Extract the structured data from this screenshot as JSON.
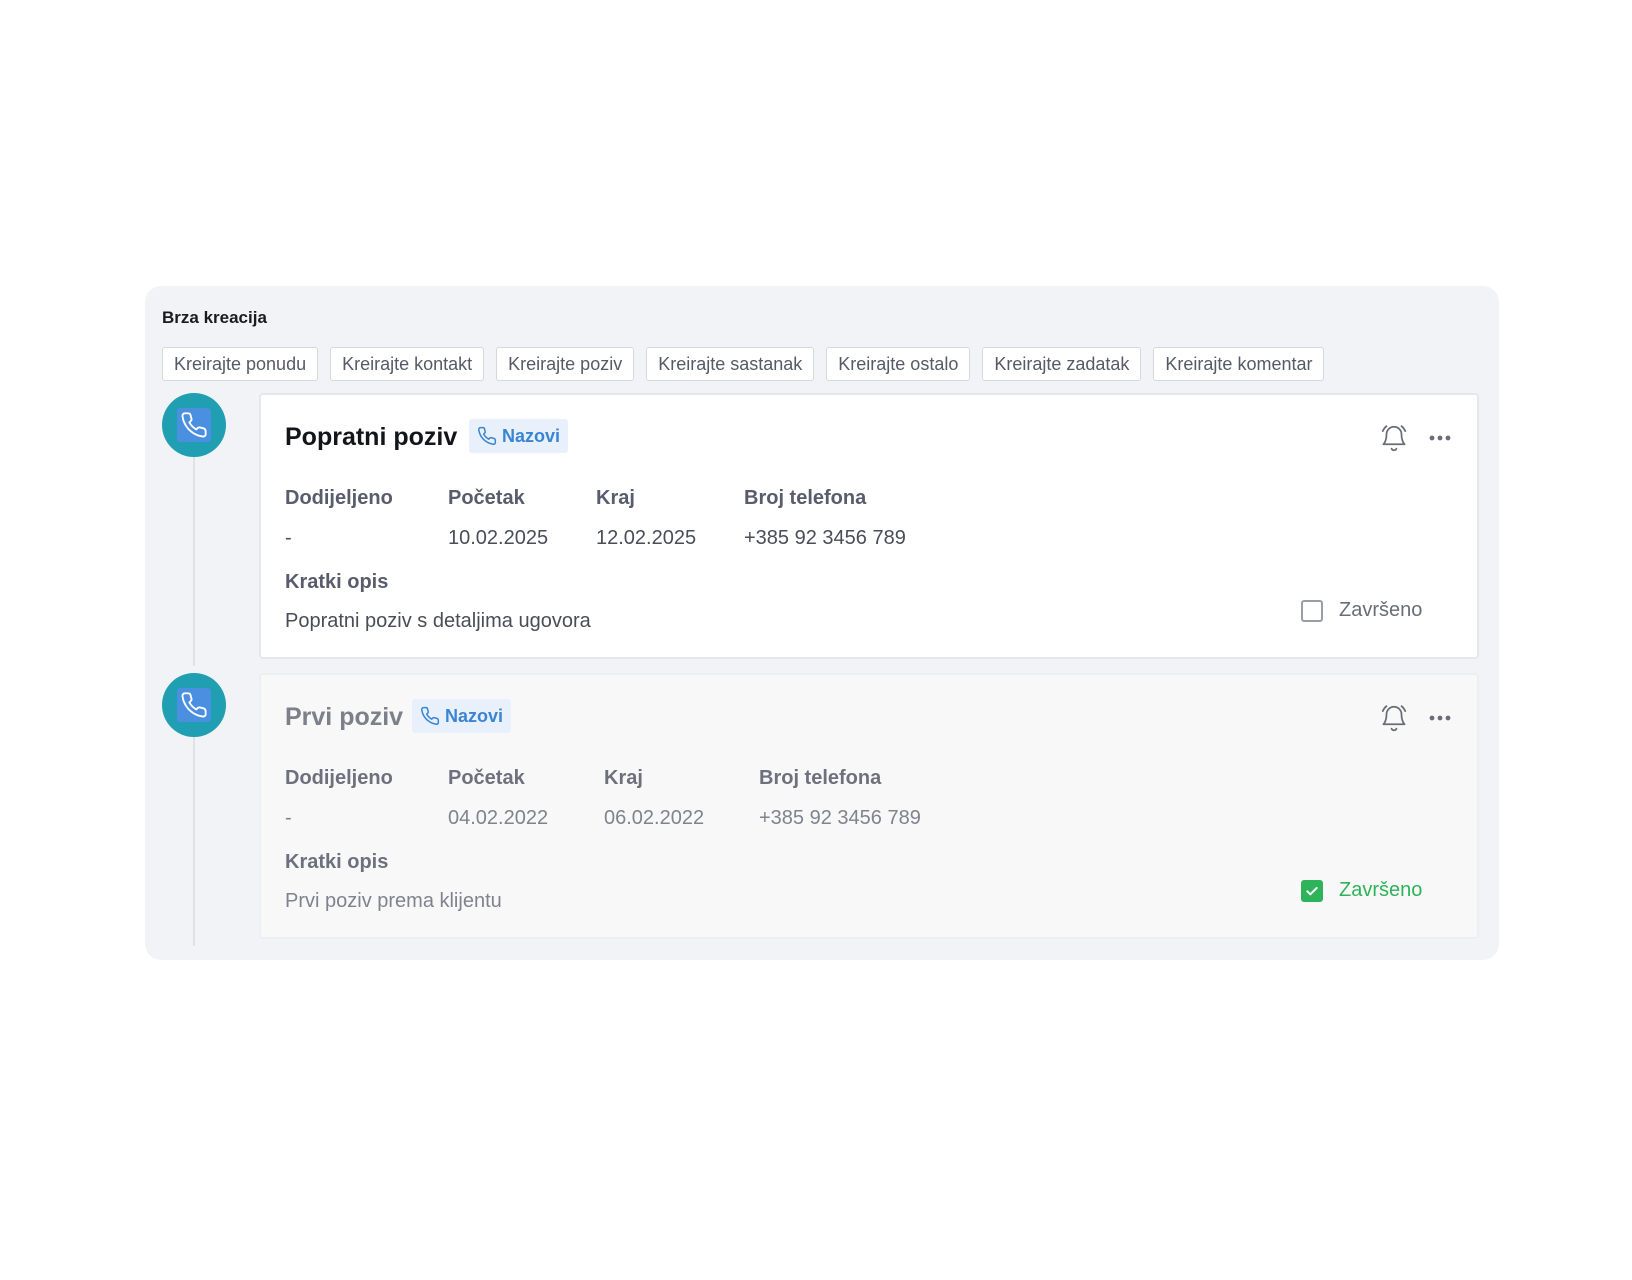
{
  "quick_create": {
    "title": "Brza kreacija",
    "buttons": [
      "Kreirajte ponudu",
      "Kreirajte kontakt",
      "Kreirajte poziv",
      "Kreirajte sastanak",
      "Kreirajte ostalo",
      "Kreirajte zadatak",
      "Kreirajte komentar"
    ]
  },
  "activities": [
    {
      "title": "Popratni poziv",
      "call_label": "Nazovi",
      "assigned_label": "Dodijeljeno",
      "assigned_value": "-",
      "start_label": "Početak",
      "start_value": "10.02.2025",
      "end_label": "Kraj",
      "end_value": "12.02.2025",
      "phone_label": "Broj telefona",
      "phone_value": "+385 92 3456 789",
      "desc_label": "Kratki opis",
      "desc_value": "Popratni poziv s detaljima ugovora",
      "complete_label": "Završeno",
      "completed": false
    },
    {
      "title": "Prvi poziv",
      "call_label": "Nazovi",
      "assigned_label": "Dodijeljeno",
      "assigned_value": "-",
      "start_label": "Početak",
      "start_value": "04.02.2022",
      "end_label": "Kraj",
      "end_value": "06.02.2022",
      "phone_label": "Broj telefona",
      "phone_value": "+385 92 3456 789",
      "desc_label": "Kratki opis",
      "desc_value": "Prvi poziv prema klijentu",
      "complete_label": "Završeno",
      "completed": true
    }
  ],
  "icons": {
    "activity": "phone-icon",
    "call": "phone-icon",
    "reminder": "bell-icon",
    "menu": "more-horizontal-icon",
    "check": "check-icon"
  },
  "colors": {
    "accent": "#1f9fb1",
    "call_chip": "#3a84d4",
    "success": "#2fb35a"
  }
}
